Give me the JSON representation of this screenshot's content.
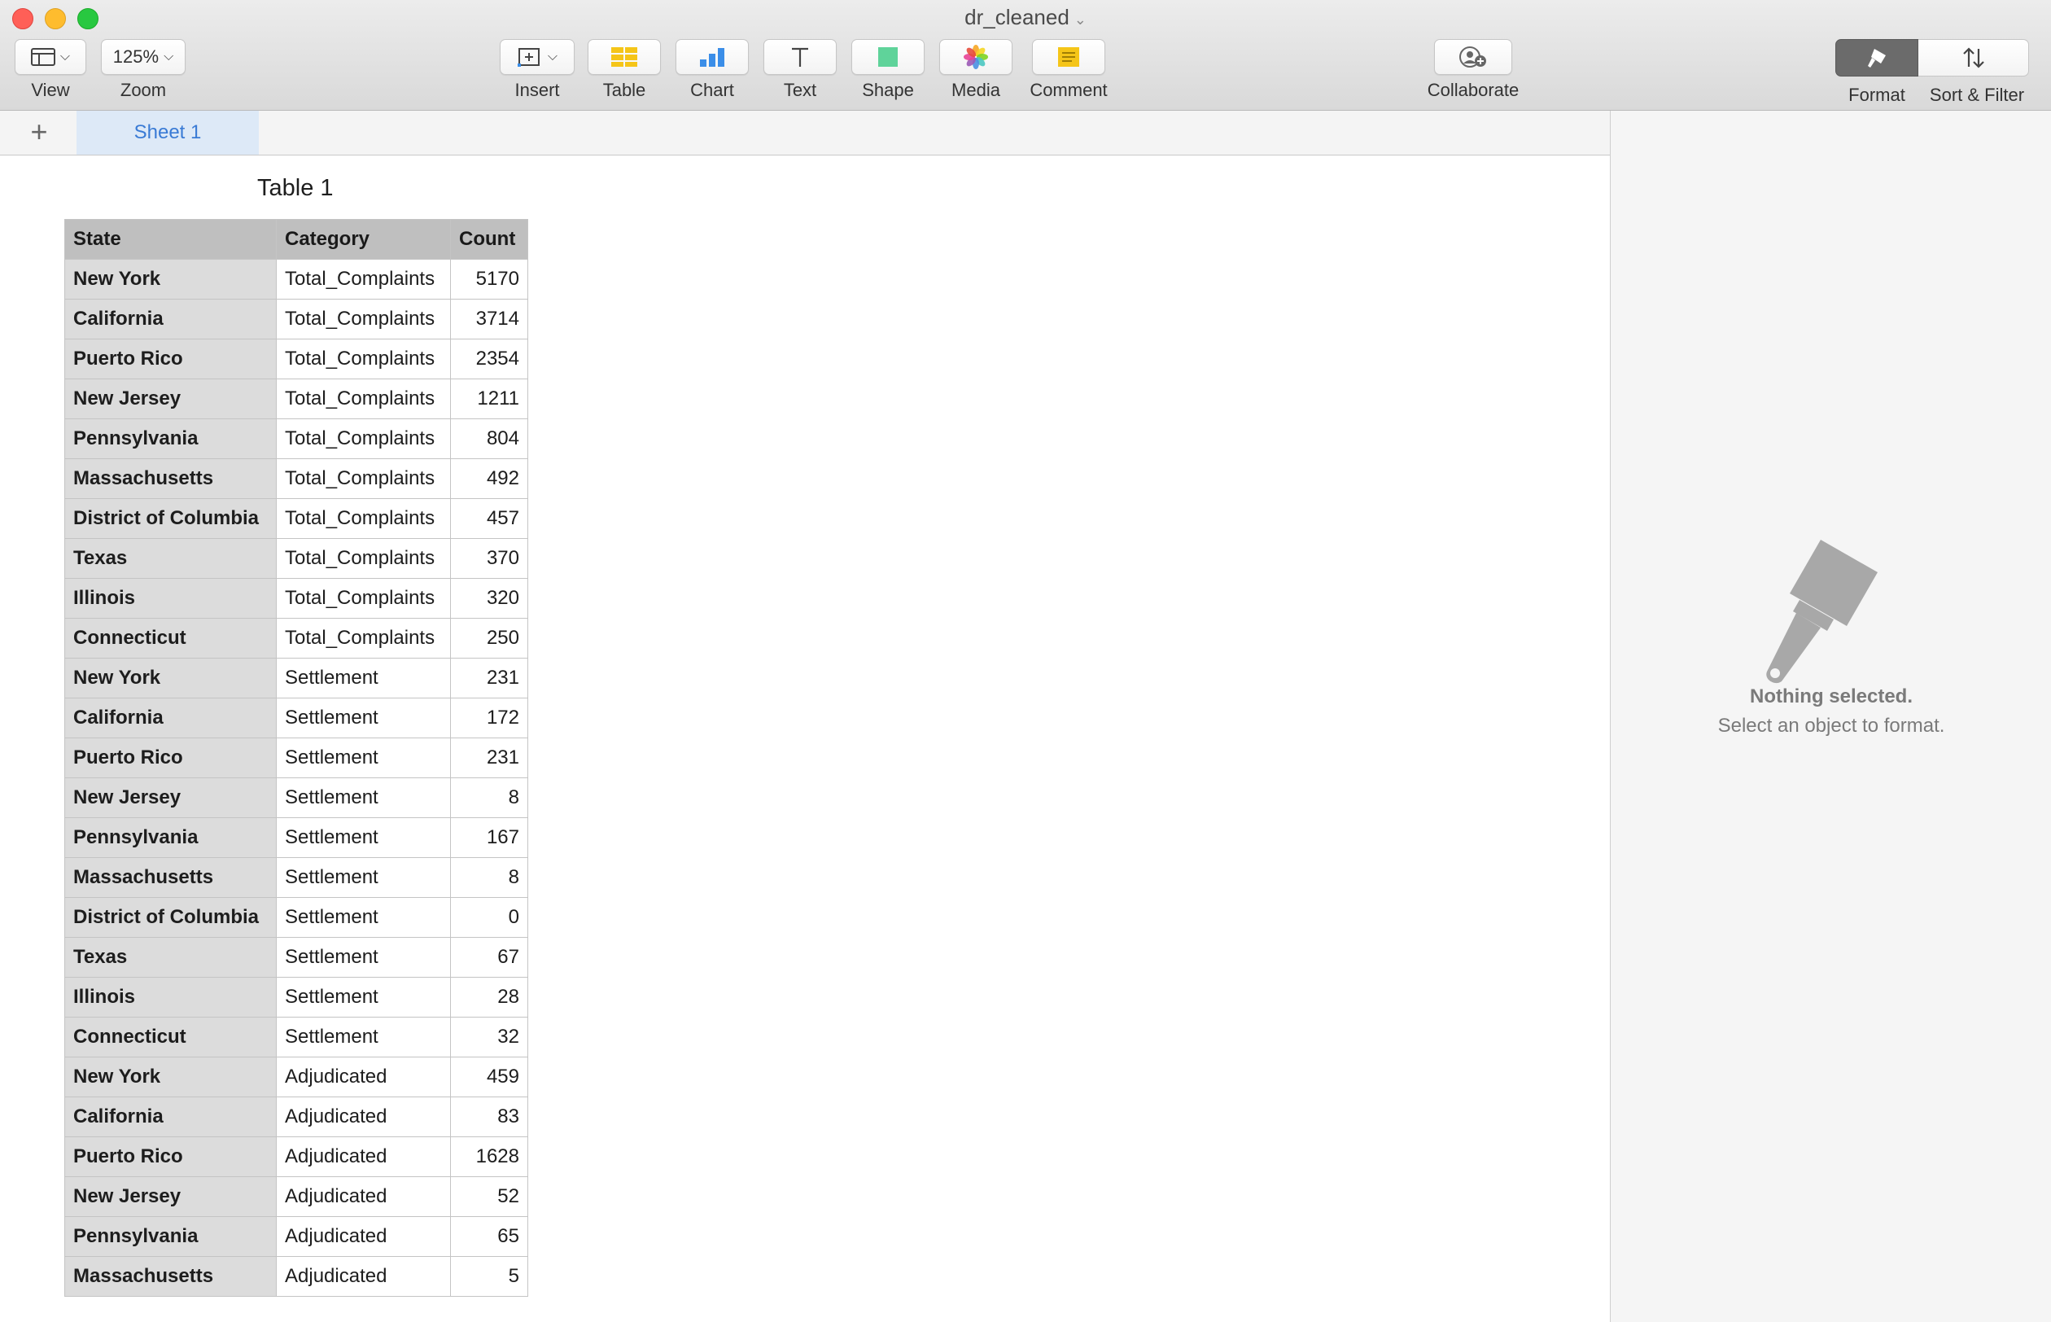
{
  "window": {
    "title": "dr_cleaned"
  },
  "toolbar": {
    "view_label": "View",
    "zoom_value": "125%",
    "zoom_label": "Zoom",
    "insert_label": "Insert",
    "table_label": "Table",
    "chart_label": "Chart",
    "text_label": "Text",
    "shape_label": "Shape",
    "media_label": "Media",
    "comment_label": "Comment",
    "collaborate_label": "Collaborate",
    "format_label": "Format",
    "sort_filter_label": "Sort & Filter"
  },
  "sheets": {
    "active": "Sheet 1"
  },
  "table": {
    "title": "Table 1",
    "headers": [
      "State",
      "Category",
      "Count"
    ],
    "rows": [
      [
        "New York",
        "Total_Complaints",
        "5170"
      ],
      [
        "California",
        "Total_Complaints",
        "3714"
      ],
      [
        "Puerto Rico",
        "Total_Complaints",
        "2354"
      ],
      [
        "New Jersey",
        "Total_Complaints",
        "1211"
      ],
      [
        "Pennsylvania",
        "Total_Complaints",
        "804"
      ],
      [
        "Massachusetts",
        "Total_Complaints",
        "492"
      ],
      [
        "District of Columbia",
        "Total_Complaints",
        "457"
      ],
      [
        "Texas",
        "Total_Complaints",
        "370"
      ],
      [
        "Illinois",
        "Total_Complaints",
        "320"
      ],
      [
        "Connecticut",
        "Total_Complaints",
        "250"
      ],
      [
        "New York",
        "Settlement",
        "231"
      ],
      [
        "California",
        "Settlement",
        "172"
      ],
      [
        "Puerto Rico",
        "Settlement",
        "231"
      ],
      [
        "New Jersey",
        "Settlement",
        "8"
      ],
      [
        "Pennsylvania",
        "Settlement",
        "167"
      ],
      [
        "Massachusetts",
        "Settlement",
        "8"
      ],
      [
        "District of Columbia",
        "Settlement",
        "0"
      ],
      [
        "Texas",
        "Settlement",
        "67"
      ],
      [
        "Illinois",
        "Settlement",
        "28"
      ],
      [
        "Connecticut",
        "Settlement",
        "32"
      ],
      [
        "New York",
        "Adjudicated",
        "459"
      ],
      [
        "California",
        "Adjudicated",
        "83"
      ],
      [
        "Puerto Rico",
        "Adjudicated",
        "1628"
      ],
      [
        "New Jersey",
        "Adjudicated",
        "52"
      ],
      [
        "Pennsylvania",
        "Adjudicated",
        "65"
      ],
      [
        "Massachusetts",
        "Adjudicated",
        "5"
      ]
    ]
  },
  "inspector": {
    "title": "Nothing selected.",
    "subtitle": "Select an object to format."
  },
  "colors": {
    "sheet_tab_text": "#3a7bd5",
    "sheet_tab_bg": "#dde9f7",
    "format_active_bg": "#6b6b6b",
    "table_icon": "#f5c518",
    "chart_icon": "#3b8ee8",
    "shape_icon": "#5fd39a",
    "comment_icon": "#f5c518"
  },
  "icons": {
    "view": "sidebar-layout-icon",
    "insert": "plus-box-icon",
    "table": "table-grid-icon",
    "chart": "bar-chart-icon",
    "text": "text-t-icon",
    "shape": "square-shape-icon",
    "media": "photos-flower-icon",
    "comment": "comment-note-icon",
    "collaborate": "person-add-icon",
    "format": "paintbrush-icon",
    "sort_filter": "up-down-arrows-icon"
  }
}
